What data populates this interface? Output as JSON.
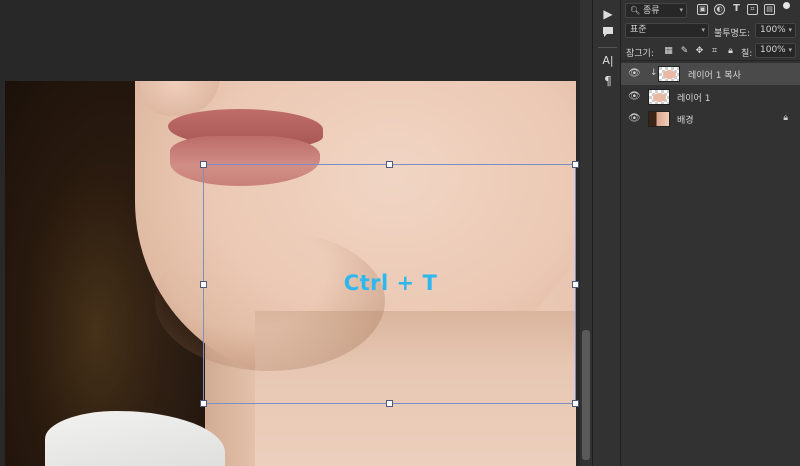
{
  "canvas": {
    "overlay_text": "Ctrl + T"
  },
  "tool_strip": {
    "icons": [
      "play-icon",
      "comment-icon",
      "character-icon",
      "paragraph-icon"
    ],
    "glyphs": {
      "play": "▶",
      "comment": "▪",
      "character": "A|",
      "paragraph": "¶"
    }
  },
  "layers_panel": {
    "filter_dropdown": "종류",
    "blend_mode": "표준",
    "opacity_label": "불투명도:",
    "opacity_value": "100%",
    "lock_label": "잠그기:",
    "fill_label": "칠:",
    "fill_value": "100%",
    "layers": [
      {
        "name": "레이어 1 복사",
        "selected": true,
        "clipped": true,
        "thumb": "transparent"
      },
      {
        "name": "레이어 1",
        "selected": false,
        "clipped": false,
        "thumb": "transparent"
      },
      {
        "name": "배경",
        "selected": false,
        "clipped": false,
        "thumb": "photo",
        "locked": true
      }
    ]
  },
  "colors": {
    "overlay_text": "#2db7ef",
    "transform_border": "#7a8fc8",
    "panel_bg": "#323232",
    "canvas_bg": "#282828"
  }
}
